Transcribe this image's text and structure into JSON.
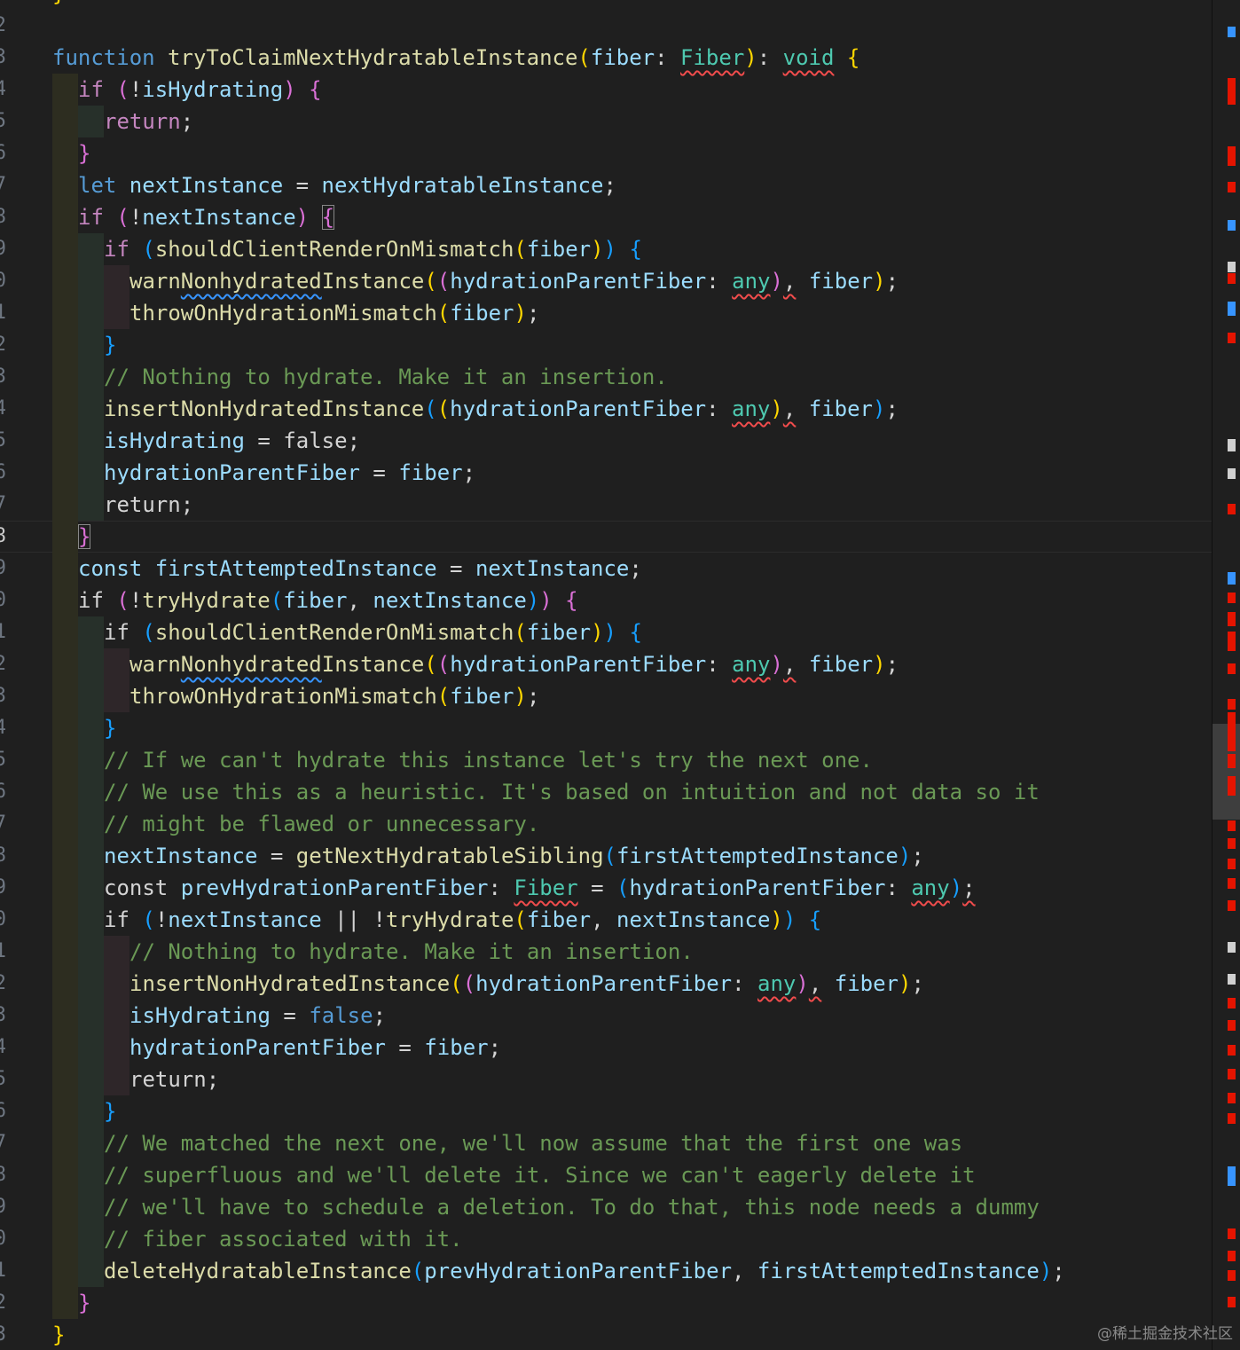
{
  "gutter": {
    "first_line_digit": 1,
    "current_line_index": 17
  },
  "code": [
    {
      "indent": 0,
      "tokens": [
        [
          "}",
          "b1"
        ]
      ]
    },
    {
      "indent": 0,
      "tokens": []
    },
    {
      "indent": 0,
      "tokens": [
        [
          "function ",
          "kw"
        ],
        [
          "tryToClaimNextHydratableInstance",
          "fn"
        ],
        [
          "(",
          "b1"
        ],
        [
          "fiber",
          "var"
        ],
        [
          ": ",
          "op"
        ],
        [
          "Fiber",
          "type err"
        ],
        [
          "",
          "b1"
        ],
        [
          ")",
          "b1"
        ],
        [
          ": ",
          "op"
        ],
        [
          "void",
          "type err"
        ],
        [
          " ",
          "op"
        ],
        [
          "{",
          "b1"
        ]
      ]
    },
    {
      "indent": 1,
      "tokens": [
        [
          "if ",
          "ctl"
        ],
        [
          "(",
          "b2"
        ],
        [
          "!",
          "op"
        ],
        [
          "isHydrating",
          "var"
        ],
        [
          ")",
          "b2"
        ],
        [
          " ",
          "op"
        ],
        [
          "{",
          "b2"
        ]
      ]
    },
    {
      "indent": 2,
      "tokens": [
        [
          "return",
          "ctl"
        ],
        [
          ";",
          "op"
        ]
      ]
    },
    {
      "indent": 1,
      "tokens": [
        [
          "}",
          "b2"
        ]
      ]
    },
    {
      "indent": 1,
      "tokens": [
        [
          "let ",
          "kw"
        ],
        [
          "nextInstance",
          "var"
        ],
        [
          " = ",
          "op"
        ],
        [
          "nextHydratableInstance",
          "var"
        ],
        [
          ";",
          "op"
        ]
      ]
    },
    {
      "indent": 1,
      "tokens": [
        [
          "if ",
          "ctl"
        ],
        [
          "(",
          "b2"
        ],
        [
          "!",
          "op"
        ],
        [
          "nextInstance",
          "var"
        ],
        [
          ")",
          "b2"
        ],
        [
          " ",
          "op"
        ],
        [
          "{",
          "b2 match"
        ]
      ]
    },
    {
      "indent": 2,
      "tokens": [
        [
          "if ",
          "ctl"
        ],
        [
          "(",
          "b3"
        ],
        [
          "shouldClientRenderOnMismatch",
          "fn"
        ],
        [
          "(",
          "b1"
        ],
        [
          "fiber",
          "var"
        ],
        [
          ")",
          "b1"
        ],
        [
          ")",
          "b3"
        ],
        [
          " ",
          "op"
        ],
        [
          "{",
          "b3"
        ]
      ]
    },
    {
      "indent": 3,
      "tokens": [
        [
          "warn",
          "fn"
        ],
        [
          "Nonhydrated",
          "fn warn"
        ],
        [
          "Instance",
          "fn"
        ],
        [
          "(",
          "b1"
        ],
        [
          "(",
          "b2"
        ],
        [
          "hydrationParentFiber",
          "var"
        ],
        [
          ": ",
          "op"
        ],
        [
          "any",
          "type err"
        ],
        [
          ")",
          "b2"
        ],
        [
          ",",
          "op err"
        ],
        [
          " ",
          "op"
        ],
        [
          "fiber",
          "var"
        ],
        [
          ")",
          "b1"
        ],
        [
          ";",
          "op"
        ]
      ]
    },
    {
      "indent": 3,
      "tokens": [
        [
          "throwOnHydrationMismatch",
          "fn"
        ],
        [
          "(",
          "b1"
        ],
        [
          "fiber",
          "var"
        ],
        [
          ")",
          "b1"
        ],
        [
          ";",
          "op"
        ]
      ]
    },
    {
      "indent": 2,
      "tokens": [
        [
          "}",
          "b3"
        ]
      ]
    },
    {
      "indent": 2,
      "tokens": [
        [
          "// Nothing to hydrate. Make it an insertion.",
          "cmt"
        ]
      ]
    },
    {
      "indent": 2,
      "tokens": [
        [
          "insertNonHydratedInstance",
          "fn"
        ],
        [
          "(",
          "b3"
        ],
        [
          "(",
          "b1"
        ],
        [
          "hydrationParentFiber",
          "var"
        ],
        [
          ": ",
          "op"
        ],
        [
          "any",
          "type err"
        ],
        [
          ")",
          "b1"
        ],
        [
          ",",
          "op err"
        ],
        [
          " ",
          "op"
        ],
        [
          "fiber",
          "var"
        ],
        [
          ")",
          "b3"
        ],
        [
          ";",
          "op"
        ]
      ]
    },
    {
      "indent": 2,
      "tokens": [
        [
          "isHydrating",
          "var"
        ],
        [
          " = ",
          "op"
        ],
        [
          "false",
          "op"
        ],
        [
          ";",
          "op"
        ]
      ]
    },
    {
      "indent": 2,
      "tokens": [
        [
          "hydrationParentFiber",
          "var"
        ],
        [
          " = ",
          "op"
        ],
        [
          "fiber",
          "var"
        ],
        [
          ";",
          "op"
        ]
      ]
    },
    {
      "indent": 2,
      "tokens": [
        [
          "return",
          "op"
        ],
        [
          ";",
          "op"
        ]
      ]
    },
    {
      "indent": 1,
      "tokens": [
        [
          "}",
          "b2 match"
        ]
      ]
    },
    {
      "indent": 1,
      "tokens": [
        [
          "const ",
          "var"
        ],
        [
          "firstAttemptedInstance",
          "var"
        ],
        [
          " = ",
          "op"
        ],
        [
          "nextInstance",
          "var"
        ],
        [
          ";",
          "op"
        ]
      ]
    },
    {
      "indent": 1,
      "tokens": [
        [
          "if ",
          "op"
        ],
        [
          "(",
          "b2"
        ],
        [
          "!",
          "op"
        ],
        [
          "tryHydrate",
          "fn"
        ],
        [
          "(",
          "b3"
        ],
        [
          "fiber",
          "var"
        ],
        [
          ", ",
          "op"
        ],
        [
          "nextInstance",
          "var"
        ],
        [
          ")",
          "b3"
        ],
        [
          ")",
          "b2"
        ],
        [
          " ",
          "op"
        ],
        [
          "{",
          "b2"
        ]
      ]
    },
    {
      "indent": 2,
      "tokens": [
        [
          "if ",
          "op"
        ],
        [
          "(",
          "b3"
        ],
        [
          "shouldClientRenderOnMismatch",
          "fn"
        ],
        [
          "(",
          "b1"
        ],
        [
          "fiber",
          "var"
        ],
        [
          ")",
          "b1"
        ],
        [
          ")",
          "b3"
        ],
        [
          " ",
          "op"
        ],
        [
          "{",
          "b3"
        ]
      ]
    },
    {
      "indent": 3,
      "tokens": [
        [
          "warn",
          "fn"
        ],
        [
          "Nonhydrated",
          "fn warn"
        ],
        [
          "Instance",
          "fn"
        ],
        [
          "(",
          "b1"
        ],
        [
          "(",
          "b2"
        ],
        [
          "hydrationParentFiber",
          "var"
        ],
        [
          ": ",
          "op"
        ],
        [
          "any",
          "type err"
        ],
        [
          ")",
          "b2"
        ],
        [
          ",",
          "op err"
        ],
        [
          " ",
          "op"
        ],
        [
          "fiber",
          "var"
        ],
        [
          ")",
          "b1"
        ],
        [
          ";",
          "op"
        ]
      ]
    },
    {
      "indent": 3,
      "tokens": [
        [
          "throwOnHydrationMismatch",
          "fn"
        ],
        [
          "(",
          "b1"
        ],
        [
          "fiber",
          "var"
        ],
        [
          ")",
          "b1"
        ],
        [
          ";",
          "op"
        ]
      ]
    },
    {
      "indent": 2,
      "tokens": [
        [
          "}",
          "b3"
        ]
      ]
    },
    {
      "indent": 2,
      "tokens": [
        [
          "// If we can't hydrate this instance let's try the next one.",
          "cmt"
        ]
      ]
    },
    {
      "indent": 2,
      "tokens": [
        [
          "// We use this as a heuristic. It's based on intuition and not data so it",
          "cmt"
        ]
      ]
    },
    {
      "indent": 2,
      "tokens": [
        [
          "// might be flawed or unnecessary.",
          "cmt"
        ]
      ]
    },
    {
      "indent": 2,
      "tokens": [
        [
          "nextInstance",
          "var"
        ],
        [
          " = ",
          "op"
        ],
        [
          "getNextHydratableSibling",
          "fn"
        ],
        [
          "(",
          "b3"
        ],
        [
          "firstAttemptedInstance",
          "var"
        ],
        [
          ")",
          "b3"
        ],
        [
          ";",
          "op"
        ]
      ]
    },
    {
      "indent": 2,
      "tokens": [
        [
          "const ",
          "op"
        ],
        [
          "prevHydrationParentFiber",
          "var"
        ],
        [
          ": ",
          "op"
        ],
        [
          "Fiber",
          "type err"
        ],
        [
          " = ",
          "op"
        ],
        [
          "(",
          "b3"
        ],
        [
          "hydrationParentFiber",
          "var"
        ],
        [
          ": ",
          "op"
        ],
        [
          "any",
          "type err"
        ],
        [
          ")",
          "b3"
        ],
        [
          ";",
          "op err"
        ]
      ]
    },
    {
      "indent": 2,
      "tokens": [
        [
          "if ",
          "op"
        ],
        [
          "(",
          "b3"
        ],
        [
          "!",
          "op"
        ],
        [
          "nextInstance",
          "var"
        ],
        [
          " || ",
          "op"
        ],
        [
          "!",
          "op"
        ],
        [
          "tryHydrate",
          "fn"
        ],
        [
          "(",
          "b1"
        ],
        [
          "fiber",
          "var"
        ],
        [
          ", ",
          "op"
        ],
        [
          "nextInstance",
          "var"
        ],
        [
          ")",
          "b1"
        ],
        [
          ")",
          "b3"
        ],
        [
          " ",
          "op"
        ],
        [
          "{",
          "b3"
        ]
      ]
    },
    {
      "indent": 3,
      "tokens": [
        [
          "// Nothing to hydrate. Make it an insertion.",
          "cmt"
        ]
      ]
    },
    {
      "indent": 3,
      "tokens": [
        [
          "insertNonHydratedInstance",
          "fn"
        ],
        [
          "(",
          "b1"
        ],
        [
          "(",
          "b2"
        ],
        [
          "hydrationParentFiber",
          "var"
        ],
        [
          ": ",
          "op"
        ],
        [
          "any",
          "type err"
        ],
        [
          ")",
          "b2"
        ],
        [
          ",",
          "op err"
        ],
        [
          " ",
          "op"
        ],
        [
          "fiber",
          "var"
        ],
        [
          ")",
          "b1"
        ],
        [
          ";",
          "op"
        ]
      ]
    },
    {
      "indent": 3,
      "tokens": [
        [
          "isHydrating",
          "var"
        ],
        [
          " = ",
          "op"
        ],
        [
          "false",
          "bool"
        ],
        [
          ";",
          "op"
        ]
      ]
    },
    {
      "indent": 3,
      "tokens": [
        [
          "hydrationParentFiber",
          "var"
        ],
        [
          " = ",
          "op"
        ],
        [
          "fiber",
          "var"
        ],
        [
          ";",
          "op"
        ]
      ]
    },
    {
      "indent": 3,
      "tokens": [
        [
          "return",
          "op"
        ],
        [
          ";",
          "op"
        ]
      ]
    },
    {
      "indent": 2,
      "tokens": [
        [
          "}",
          "b3"
        ]
      ]
    },
    {
      "indent": 2,
      "tokens": [
        [
          "// We matched the next one, we'll now assume that the first one was",
          "cmt"
        ]
      ]
    },
    {
      "indent": 2,
      "tokens": [
        [
          "// superfluous and we'll delete it. Since we can't eagerly delete it",
          "cmt"
        ]
      ]
    },
    {
      "indent": 2,
      "tokens": [
        [
          "// we'll have to schedule a deletion. To do that, this node needs a dummy",
          "cmt"
        ]
      ]
    },
    {
      "indent": 2,
      "tokens": [
        [
          "// fiber associated with it.",
          "cmt"
        ]
      ]
    },
    {
      "indent": 2,
      "tokens": [
        [
          "deleteHydratableInstance",
          "fn"
        ],
        [
          "(",
          "b3"
        ],
        [
          "prevHydrationParentFiber",
          "var"
        ],
        [
          ", ",
          "op"
        ],
        [
          "firstAttemptedInstance",
          "var"
        ],
        [
          ")",
          "b3"
        ],
        [
          ";",
          "op"
        ]
      ]
    },
    {
      "indent": 1,
      "tokens": [
        [
          "}",
          "b2"
        ]
      ]
    },
    {
      "indent": 0,
      "tokens": [
        [
          "}",
          "b1"
        ]
      ]
    }
  ],
  "colors": {
    "guide_level_1": "#2d2d20",
    "guide_level_2": "#27302a",
    "guide_level_3": "#2e2629",
    "error_marker": "#e51400",
    "info_marker": "#3794ff"
  },
  "watermark": "@稀土掘金技术社区"
}
